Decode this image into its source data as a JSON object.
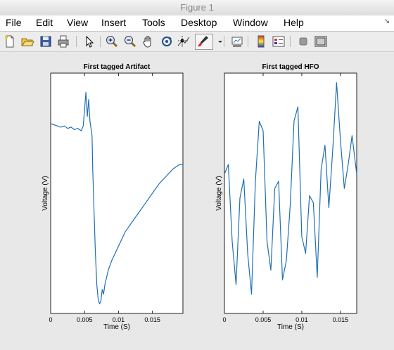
{
  "window": {
    "title": "Figure 1"
  },
  "menu": [
    "File",
    "Edit",
    "View",
    "Insert",
    "Tools",
    "Desktop",
    "Window",
    "Help"
  ],
  "toolbar_icons": [
    "new-figure-icon",
    "open-file-icon",
    "save-icon",
    "print-icon",
    "pointer-icon",
    "zoom-in-icon",
    "zoom-out-icon",
    "pan-hand-icon",
    "rotate-3d-icon",
    "data-cursor-icon",
    "brush-icon",
    "brush-dropdown-icon",
    "link-plot-icon",
    "colorbar-icon",
    "legend-icon",
    "hide-plot-tools-icon",
    "show-plot-tools-icon"
  ],
  "colors": {
    "line": "#1f6fb3",
    "axes_bg": "#ffffff",
    "figure_bg": "#e8e8e8"
  },
  "chart_data": [
    {
      "type": "line",
      "title": "First tagged Artifact",
      "xlabel": "Time (S)",
      "ylabel": "Voltage (V)",
      "xlim": [
        0,
        0.0195
      ],
      "ylim": [
        0,
        1
      ],
      "xticks": [
        0,
        0.005,
        0.01,
        0.015
      ],
      "xtick_labels": [
        "0",
        "0.005",
        "0.01",
        "0.015"
      ],
      "y_tick_labels_shown": false,
      "grid": false,
      "series": [
        {
          "x": [
            0,
            0.0005,
            0.001,
            0.0015,
            0.002,
            0.0025,
            0.003,
            0.0035,
            0.004,
            0.0045,
            0.0048,
            0.005,
            0.0052,
            0.0054,
            0.0056,
            0.0058,
            0.006,
            0.0061,
            0.0062,
            0.0064,
            0.0066,
            0.0068,
            0.007,
            0.0072,
            0.0074,
            0.0076,
            0.0078,
            0.008,
            0.0085,
            0.009,
            0.0095,
            0.01,
            0.011,
            0.012,
            0.013,
            0.014,
            0.015,
            0.016,
            0.017,
            0.018,
            0.019,
            0.0195
          ],
          "y": [
            0.79,
            0.785,
            0.78,
            0.775,
            0.78,
            0.77,
            0.775,
            0.765,
            0.77,
            0.76,
            0.78,
            0.85,
            0.92,
            0.82,
            0.89,
            0.8,
            0.76,
            0.74,
            0.6,
            0.42,
            0.25,
            0.12,
            0.06,
            0.04,
            0.05,
            0.1,
            0.08,
            0.12,
            0.18,
            0.22,
            0.25,
            0.28,
            0.34,
            0.38,
            0.42,
            0.46,
            0.5,
            0.54,
            0.57,
            0.6,
            0.62,
            0.62
          ]
        }
      ]
    },
    {
      "type": "line",
      "title": "First tagged HFO",
      "xlabel": "Time (S)",
      "ylabel": "Voltage (V)",
      "xlim": [
        0,
        0.0171
      ],
      "ylim": [
        0,
        1
      ],
      "xticks": [
        0,
        0.005,
        0.01,
        0.015
      ],
      "xtick_labels": [
        "0",
        "0.005",
        "0.01",
        "0.015"
      ],
      "y_tick_labels_shown": false,
      "grid": false,
      "series": [
        {
          "x": [
            0,
            0.0005,
            0.001,
            0.0015,
            0.002,
            0.0025,
            0.003,
            0.0035,
            0.004,
            0.0045,
            0.005,
            0.0055,
            0.006,
            0.0065,
            0.007,
            0.0075,
            0.008,
            0.0085,
            0.009,
            0.0095,
            0.01,
            0.0105,
            0.011,
            0.0115,
            0.012,
            0.0125,
            0.013,
            0.0135,
            0.014,
            0.0145,
            0.015,
            0.0155,
            0.016,
            0.0165,
            0.0171
          ],
          "y": [
            0.58,
            0.62,
            0.3,
            0.12,
            0.48,
            0.56,
            0.25,
            0.08,
            0.55,
            0.8,
            0.76,
            0.3,
            0.18,
            0.52,
            0.55,
            0.14,
            0.22,
            0.45,
            0.8,
            0.86,
            0.32,
            0.25,
            0.49,
            0.46,
            0.15,
            0.6,
            0.7,
            0.44,
            0.68,
            0.96,
            0.72,
            0.52,
            0.62,
            0.74,
            0.58
          ]
        }
      ]
    }
  ]
}
